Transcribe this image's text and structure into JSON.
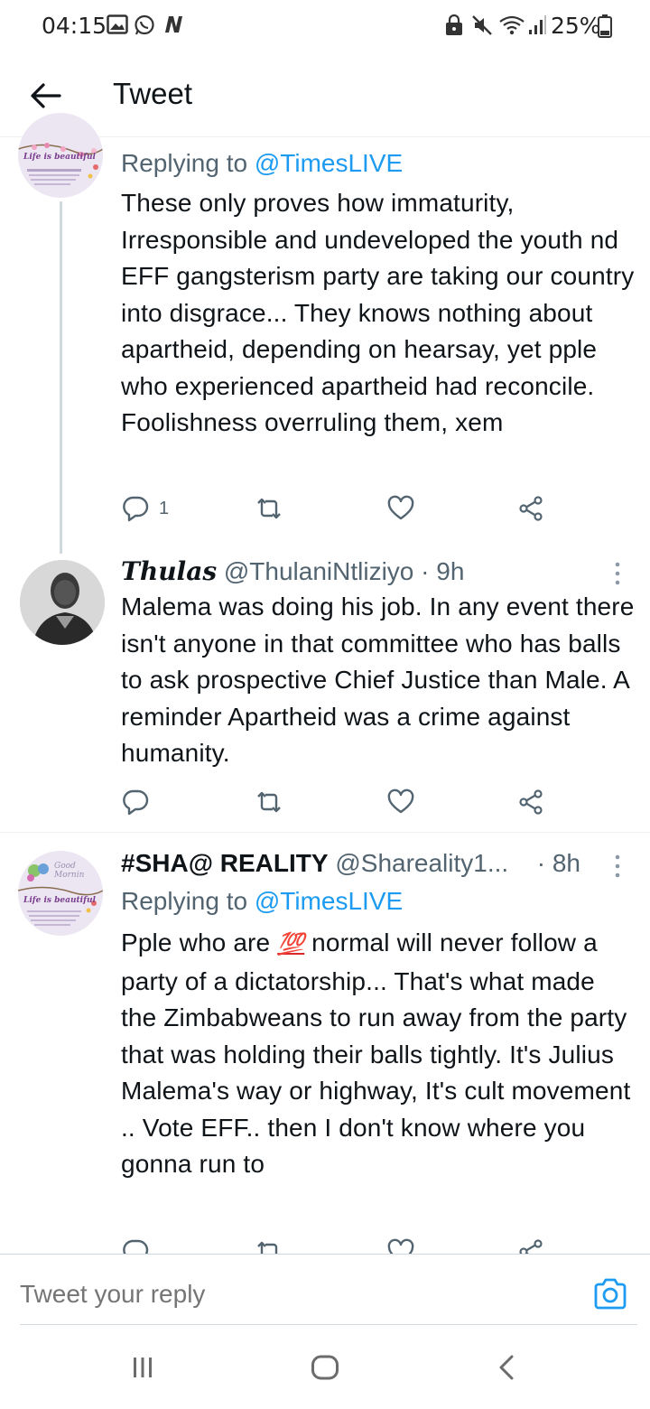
{
  "status_bar": {
    "time": "04:15",
    "battery": "25%",
    "icons": [
      "gallery-icon",
      "whatsapp-icon",
      "n-app-icon",
      "lock-icon",
      "mute-icon",
      "wifi-icon",
      "signal-icon",
      "battery-icon"
    ]
  },
  "header": {
    "title": "Tweet",
    "back_icon": "arrow-left-icon"
  },
  "tweets": [
    {
      "reply_label": "Replying to",
      "reply_handle": "@TimesLIVE",
      "text": "These only proves how immaturity, Irresponsible and undeveloped the youth nd EFF gangsterism party are taking our country into disgrace... They knows nothing about apartheid, depending on hearsay, yet pple who experienced apartheid had reconcile. Foolishness overruling them, xem",
      "avatar_text": "Life is beautiful",
      "reply_count": "1"
    },
    {
      "display_name": "Thulas",
      "handle": "@ThulaniNtliziyo",
      "separator": "·",
      "time": "9h",
      "text": "Malema was doing his job. In any event there isn't anyone in that committee who has balls to ask prospective Chief Justice than Male. A reminder Apartheid was a crime against humanity."
    },
    {
      "display_name": "#SHA@ REALITY",
      "handle": "@Shareality1...",
      "separator": "·",
      "time": "8h",
      "reply_label": "Replying to",
      "reply_handle": "@TimesLIVE",
      "text_before_emoji": "Pple who are ",
      "emoji": "💯",
      "text_after_emoji": " normal will never follow a party of a dictatorship... That's what made the Zimbabweans to run away from the party that was holding their balls tightly. It's Julius Malema's way or highway, It's  cult movement .. Vote EFF.. then I don't know where you gonna run to",
      "avatar_text_top": "Good Mornin",
      "avatar_text": "Life is beautiful"
    }
  ],
  "composer": {
    "placeholder": "Tweet your reply"
  },
  "colors": {
    "accent": "#1d9bf0",
    "secondary_text": "#536471",
    "primary_text": "#0f1419"
  }
}
